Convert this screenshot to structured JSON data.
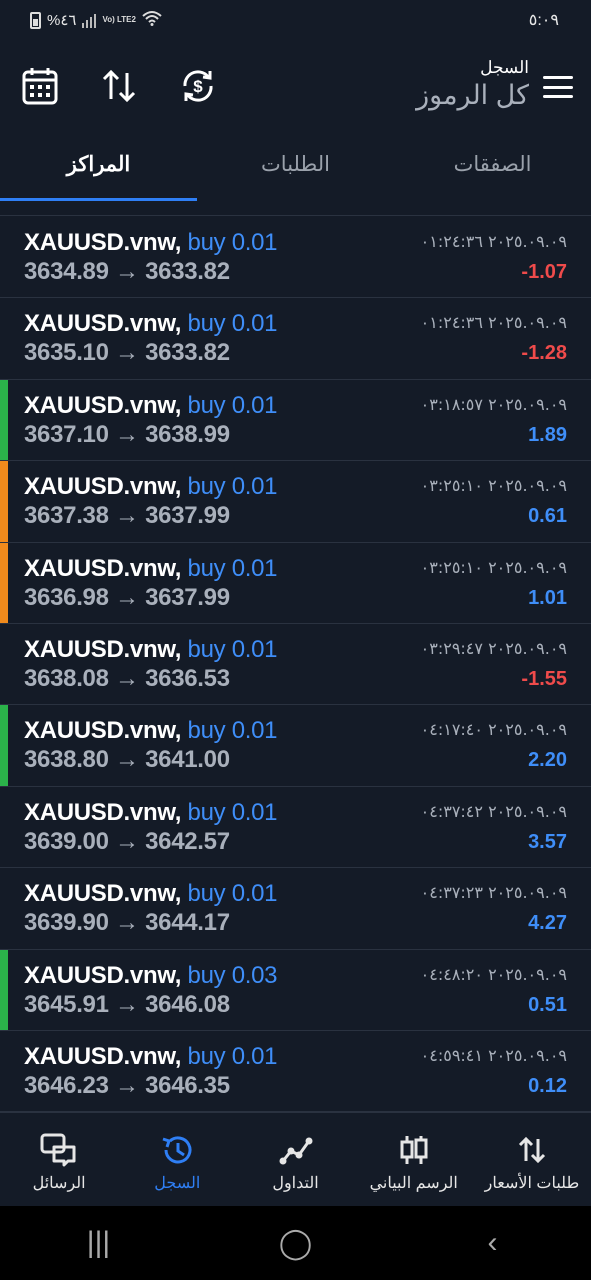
{
  "status": {
    "battery": "%٤٦",
    "network": "Vo) LTE2",
    "time": "٥:٠٩"
  },
  "header": {
    "title": "السجل",
    "subtitle": "كل الرموز",
    "icons": [
      "calendar-icon",
      "sort-icon",
      "currency-exchange-icon",
      "menu-icon"
    ]
  },
  "tabs": [
    {
      "label": "المراكز",
      "active": true
    },
    {
      "label": "الطلبات",
      "active": false
    },
    {
      "label": "الصفقات",
      "active": false
    }
  ],
  "colors": {
    "background": "#141b27",
    "accent": "#2f7ff5",
    "buy": "#3f8ef8",
    "loss": "#ef4b4b",
    "marker_green": "#2bb34a",
    "marker_orange": "#f08a1c"
  },
  "deals": [
    {
      "symbol": "XAUUSD.vnw,",
      "side": "buy 0.01",
      "open": "3634.89",
      "arrow": "→",
      "close": "3633.82",
      "datetime": "٢٠٢٥.٠٩.٠٩ ٠١:٢٤:٣٦",
      "profit": "-1.07",
      "marker": ""
    },
    {
      "symbol": "XAUUSD.vnw,",
      "side": "buy 0.01",
      "open": "3635.10",
      "arrow": "→",
      "close": "3633.82",
      "datetime": "٢٠٢٥.٠٩.٠٩ ٠١:٢٤:٣٦",
      "profit": "-1.28",
      "marker": ""
    },
    {
      "symbol": "XAUUSD.vnw,",
      "side": "buy 0.01",
      "open": "3637.10",
      "arrow": "→",
      "close": "3638.99",
      "datetime": "٢٠٢٥.٠٩.٠٩ ٠٣:١٨:٥٧",
      "profit": "1.89",
      "marker": "green"
    },
    {
      "symbol": "XAUUSD.vnw,",
      "side": "buy 0.01",
      "open": "3637.38",
      "arrow": "→",
      "close": "3637.99",
      "datetime": "٢٠٢٥.٠٩.٠٩ ٠٣:٢٥:١٠",
      "profit": "0.61",
      "marker": "orange"
    },
    {
      "symbol": "XAUUSD.vnw,",
      "side": "buy 0.01",
      "open": "3636.98",
      "arrow": "→",
      "close": "3637.99",
      "datetime": "٢٠٢٥.٠٩.٠٩ ٠٣:٢٥:١٠",
      "profit": "1.01",
      "marker": "orange"
    },
    {
      "symbol": "XAUUSD.vnw,",
      "side": "buy 0.01",
      "open": "3638.08",
      "arrow": "→",
      "close": "3636.53",
      "datetime": "٢٠٢٥.٠٩.٠٩ ٠٣:٢٩:٤٧",
      "profit": "-1.55",
      "marker": ""
    },
    {
      "symbol": "XAUUSD.vnw,",
      "side": "buy 0.01",
      "open": "3638.80",
      "arrow": "→",
      "close": "3641.00",
      "datetime": "٢٠٢٥.٠٩.٠٩ ٠٤:١٧:٤٠",
      "profit": "2.20",
      "marker": "green"
    },
    {
      "symbol": "XAUUSD.vnw,",
      "side": "buy 0.01",
      "open": "3639.00",
      "arrow": "→",
      "close": "3642.57",
      "datetime": "٢٠٢٥.٠٩.٠٩ ٠٤:٣٧:٤٢",
      "profit": "3.57",
      "marker": ""
    },
    {
      "symbol": "XAUUSD.vnw,",
      "side": "buy 0.01",
      "open": "3639.90",
      "arrow": "→",
      "close": "3644.17",
      "datetime": "٢٠٢٥.٠٩.٠٩ ٠٤:٣٧:٢٣",
      "profit": "4.27",
      "marker": ""
    },
    {
      "symbol": "XAUUSD.vnw,",
      "side": "buy 0.03",
      "open": "3645.91",
      "arrow": "→",
      "close": "3646.08",
      "datetime": "٢٠٢٥.٠٩.٠٩ ٠٤:٤٨:٢٠",
      "profit": "0.51",
      "marker": "green"
    },
    {
      "symbol": "XAUUSD.vnw,",
      "side": "buy 0.01",
      "open": "3646.23",
      "arrow": "→",
      "close": "3646.35",
      "datetime": "٢٠٢٥.٠٩.٠٩ ٠٤:٥٩:٤١",
      "profit": "0.12",
      "marker": ""
    }
  ],
  "bottom_nav": [
    {
      "label": "الرسائل",
      "icon": "chat-icon",
      "active": false
    },
    {
      "label": "السجل",
      "icon": "history-icon",
      "active": true
    },
    {
      "label": "التداول",
      "icon": "trade-icon",
      "active": false
    },
    {
      "label": "الرسم البياني",
      "icon": "chart-icon",
      "active": false
    },
    {
      "label": "طلبات الأسعار",
      "icon": "quotes-icon",
      "active": false
    }
  ],
  "system_nav": {
    "recents": "|||",
    "home": "◯",
    "back": "‹"
  }
}
